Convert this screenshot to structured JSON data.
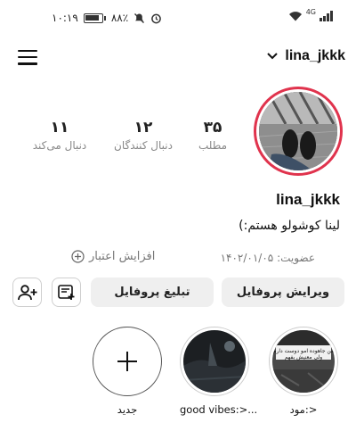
{
  "status_bar": {
    "time": "۱۰:۱۹",
    "battery": "۸۸٪",
    "network": "4G"
  },
  "header": {
    "username": "lina_jkkk",
    "menu_icon": "hamburger-menu-icon",
    "dropdown_icon": "chevron-down-icon"
  },
  "profile": {
    "username": "lina_jkkk",
    "bio": "لینا کوشولو هستم:)",
    "joined": "عضویت: ۱۴۰۲/۰۱/۰۵",
    "credit": "افزایش اعتبار",
    "avatar_ring_color": "#e0334d"
  },
  "stats": {
    "posts": {
      "value": "۳۵",
      "label": "مطلب"
    },
    "followers": {
      "value": "۱۲",
      "label": "دنبال کنندگان"
    },
    "following": {
      "value": "۱۱",
      "label": "دنبال می‌کند"
    }
  },
  "buttons": {
    "edit_profile": "ویرایش پروفایل",
    "promote_profile": "تبلیغ پروفایل",
    "add_user_icon": "add-user-icon",
    "add_story_icon": "add-post-icon"
  },
  "highlights": [
    {
      "label": "جدید",
      "icon": "plus-icon"
    },
    {
      "label": "good vibes:>...",
      "icon": ""
    },
    {
      "label": "مود:>",
      "image_text": "من جاهوده امو دوست دارم ولی معنیش بفهم"
    }
  ]
}
